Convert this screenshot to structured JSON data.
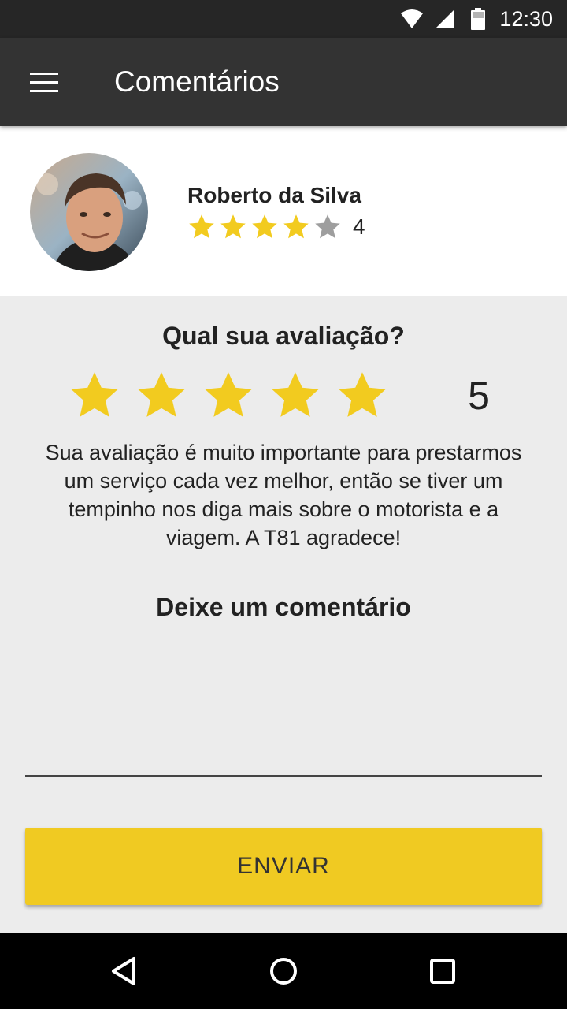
{
  "status_bar": {
    "time": "12:30",
    "icons": [
      "wifi-icon",
      "cell-signal-icon",
      "battery-icon"
    ]
  },
  "app_bar": {
    "title": "Comentários",
    "menu_icon": "hamburger-menu-icon"
  },
  "driver": {
    "name": "Roberto da Silva",
    "rating": 4,
    "rating_text": "4",
    "max_rating": 5
  },
  "review": {
    "question": "Qual sua avaliação?",
    "selected_rating": 5,
    "selected_rating_text": "5",
    "info": "Sua avaliação é muito importante para prestarmos um serviço cada vez melhor, então se tiver um tempinho nos diga mais sobre o motorista e a viagem. A T81 agradece!",
    "comment_label": "Deixe um comentário",
    "comment_value": "",
    "submit_label": "ENVIAR"
  },
  "nav_bar": {
    "buttons": [
      "back-icon",
      "home-icon",
      "recents-icon"
    ]
  },
  "colors": {
    "accent": "#f0ca22",
    "star_filled": "#f2cb1f",
    "star_empty": "#9e9e9e",
    "app_bar": "#333333",
    "status_bar": "#262626",
    "background": "#ececec"
  }
}
